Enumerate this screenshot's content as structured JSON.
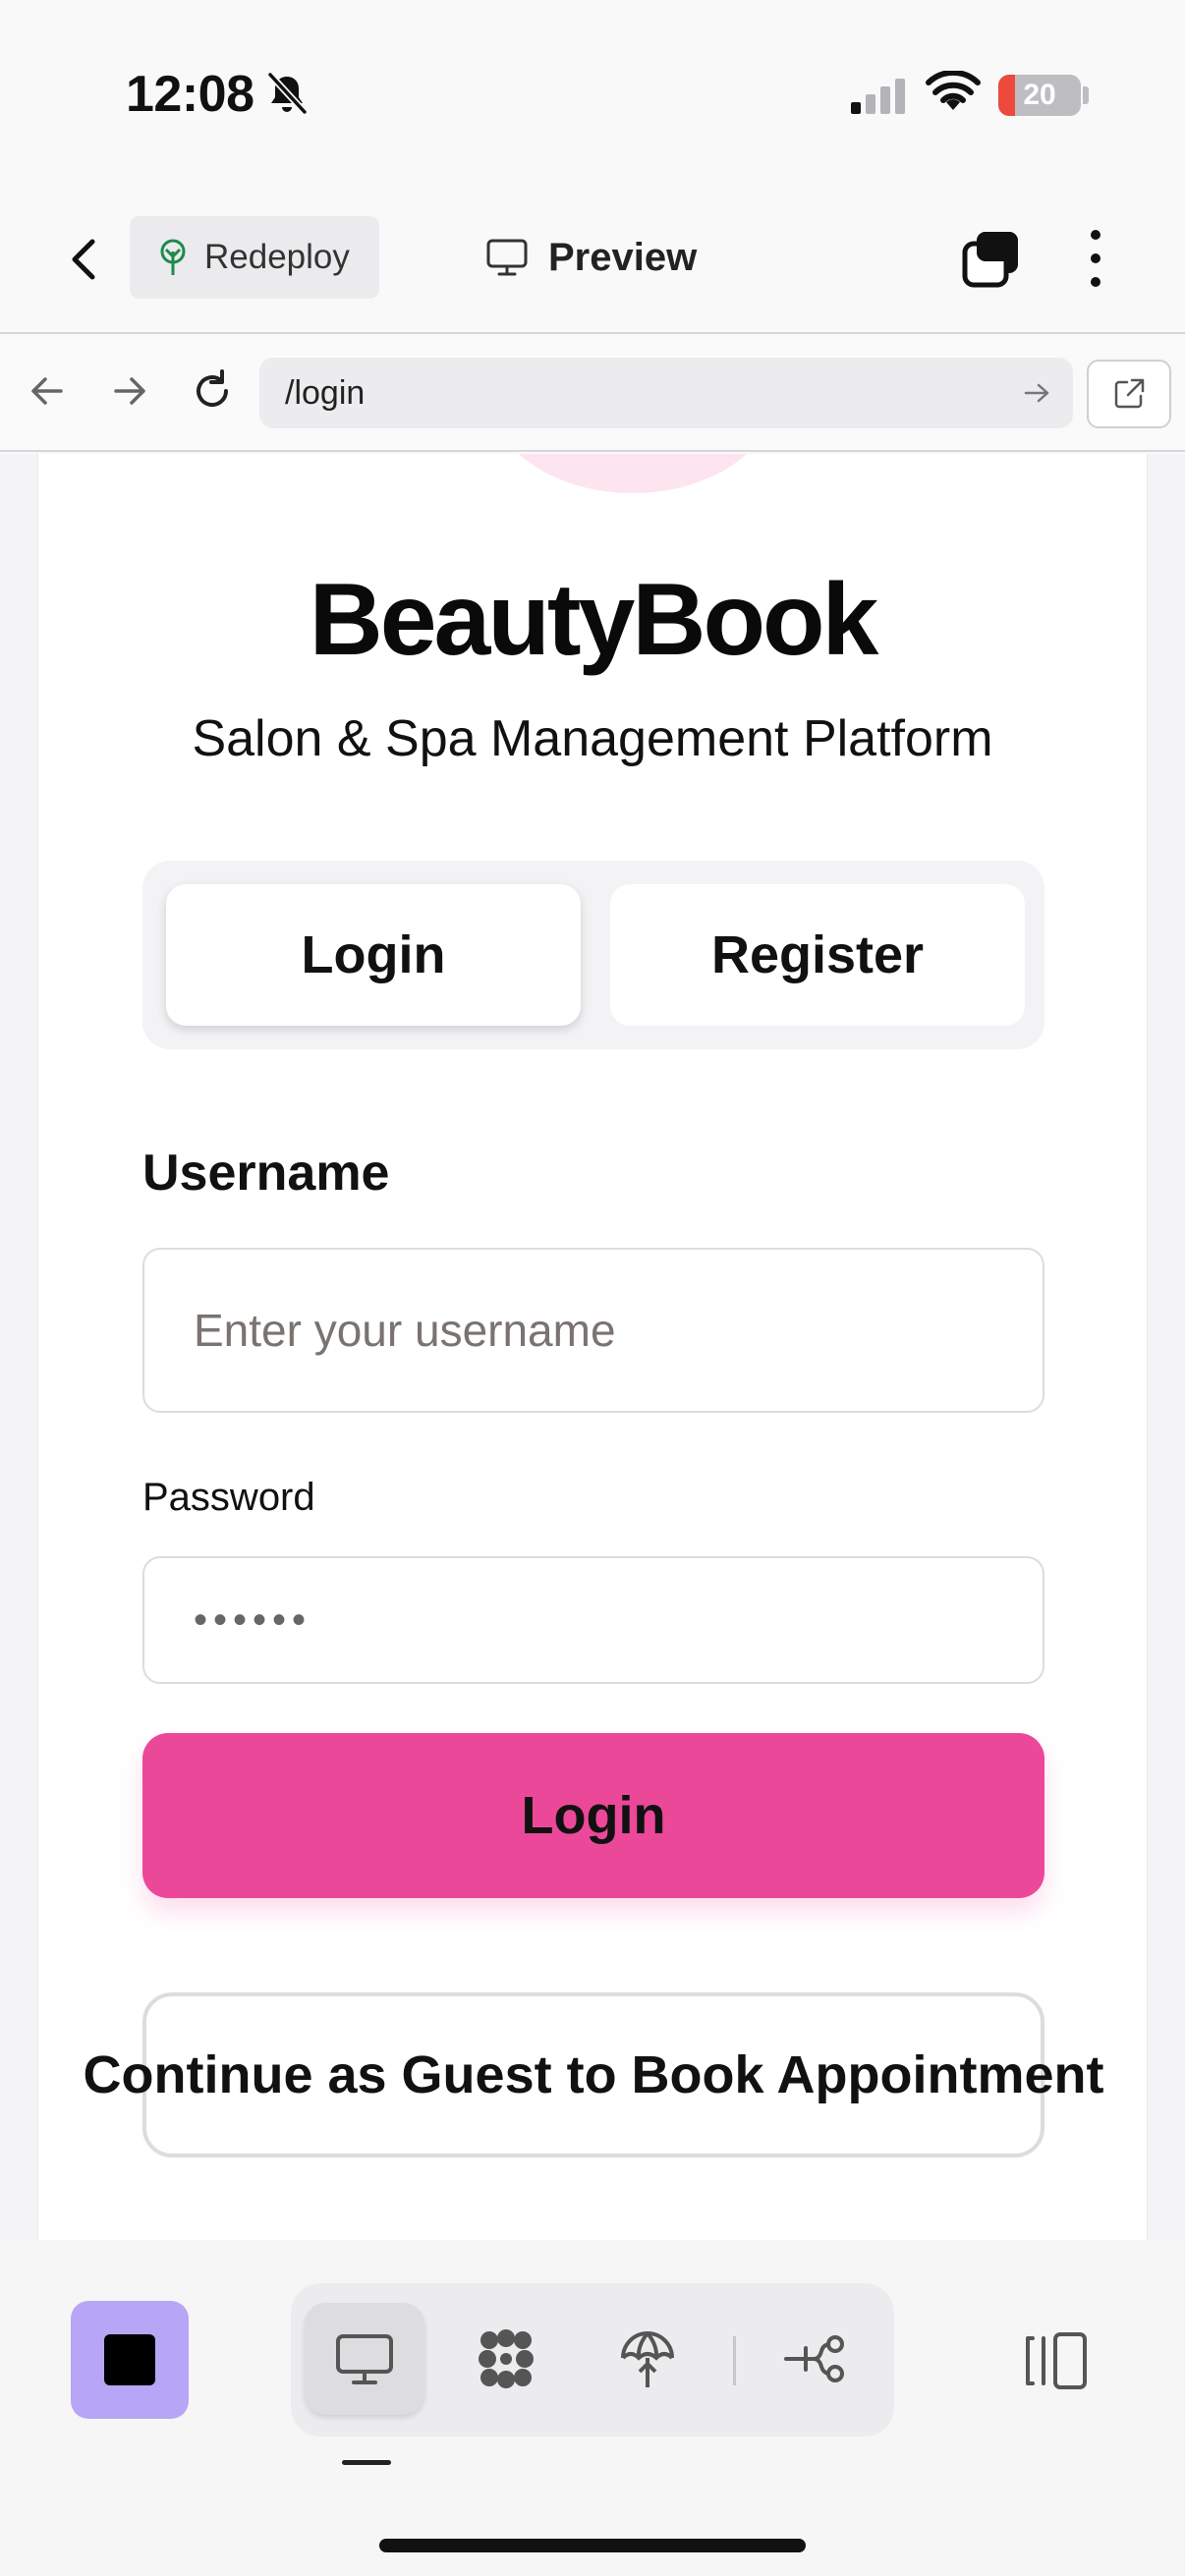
{
  "status_bar": {
    "time": "12:08",
    "battery_level": "20",
    "battery_fraction": 0.2
  },
  "app_toolbar": {
    "redeploy_label": "Redeploy",
    "preview_label": "Preview"
  },
  "browser": {
    "url": "/login"
  },
  "login_page": {
    "brand": "BeautyBook",
    "tagline": "Salon & Spa Management Platform",
    "tabs": [
      {
        "label": "Login",
        "active": true
      },
      {
        "label": "Register",
        "active": false
      }
    ],
    "username_label": "Username",
    "username_placeholder": "Enter your username",
    "password_label": "Password",
    "password_value": "••••••",
    "submit_label": "Login",
    "guest_label": "Continue as Guest to Book Appointment"
  },
  "colors": {
    "accent_pink": "#ec4899",
    "stop_button": "#b7a6f6",
    "battery_low": "#eb4a3c"
  },
  "icons": {
    "status": [
      "bell-off-icon",
      "cellular-signal-icon",
      "wifi-icon",
      "battery-icon"
    ],
    "toolbar": [
      "chevron-left-icon",
      "tree-icon",
      "monitor-icon",
      "tabs-icon",
      "more-vertical-icon"
    ],
    "browser": [
      "arrow-left-icon",
      "arrow-right-icon",
      "reload-icon",
      "arrow-go-icon",
      "external-link-icon"
    ],
    "bottom": [
      "stop-icon",
      "monitor-icon",
      "workspace-icon",
      "deploy-icon",
      "git-branch-icon",
      "side-panel-icon"
    ]
  }
}
